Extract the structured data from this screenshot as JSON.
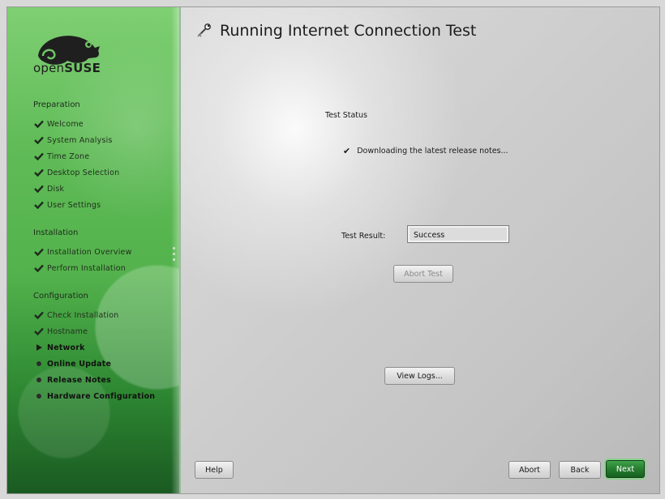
{
  "sidebar": {
    "logo_text_light": "open",
    "logo_text_bold": "SUSE",
    "sections": [
      {
        "title": "Preparation",
        "steps": [
          {
            "label": "Welcome",
            "state": "done"
          },
          {
            "label": "System Analysis",
            "state": "done"
          },
          {
            "label": "Time Zone",
            "state": "done"
          },
          {
            "label": "Desktop Selection",
            "state": "done"
          },
          {
            "label": "Disk",
            "state": "done"
          },
          {
            "label": "User Settings",
            "state": "done"
          }
        ]
      },
      {
        "title": "Installation",
        "steps": [
          {
            "label": "Installation Overview",
            "state": "done"
          },
          {
            "label": "Perform Installation",
            "state": "done"
          }
        ]
      },
      {
        "title": "Configuration",
        "steps": [
          {
            "label": "Check Installation",
            "state": "done"
          },
          {
            "label": "Hostname",
            "state": "done"
          },
          {
            "label": "Network",
            "state": "current"
          },
          {
            "label": "Online Update",
            "state": "pending"
          },
          {
            "label": "Release Notes",
            "state": "pending"
          },
          {
            "label": "Hardware Configuration",
            "state": "pending"
          }
        ]
      }
    ]
  },
  "main": {
    "title": "Running Internet Connection Test",
    "test_status_label": "Test Status",
    "status_check": "✔",
    "status_message": "Downloading the latest release notes...",
    "test_result_label": "Test Result:",
    "test_result_value": "Success",
    "abort_test_label": "Abort Test",
    "view_logs_label": "View Logs..."
  },
  "footer": {
    "help_label": "Help",
    "abort_label": "Abort",
    "back_label": "Back",
    "next_label": "Next"
  },
  "colors": {
    "sidebar_green": "#53b24c",
    "next_button": "#247a2e"
  }
}
